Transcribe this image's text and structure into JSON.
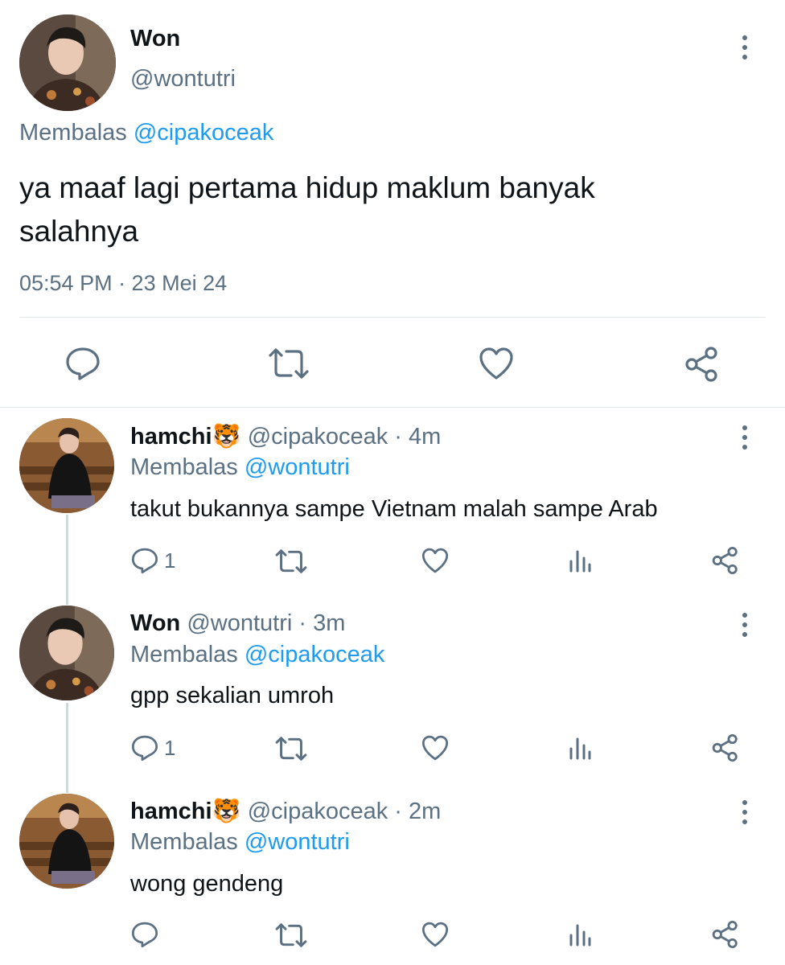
{
  "main_tweet": {
    "display_name": "Won",
    "handle": "@wontutri",
    "reply_prefix": "Membalas",
    "reply_to": "@cipakoceak",
    "text_line1": "ya maaf lagi pertama hidup maklum banyak",
    "text_line2": "salahnya",
    "timestamp": "05:54 PM · 23 Mei 24",
    "actions": [
      "reply-icon",
      "retweet-icon",
      "like-icon",
      "share-icon"
    ]
  },
  "replies": [
    {
      "display_name": "hamchi",
      "emoji": "🐯",
      "handle": "@cipakoceak",
      "time": "· 4m",
      "reply_prefix": "Membalas",
      "reply_to": "@wontutri",
      "text": "takut bukannya sampe Vietnam malah sampe Arab",
      "reply_count": "1",
      "actions": [
        "reply-icon",
        "retweet-icon",
        "like-icon",
        "analytics-icon",
        "share-icon"
      ]
    },
    {
      "display_name": "Won",
      "emoji": "",
      "handle": "@wontutri",
      "time": "· 3m",
      "reply_prefix": "Membalas",
      "reply_to": "@cipakoceak",
      "text": "gpp sekalian umroh",
      "reply_count": "1",
      "actions": [
        "reply-icon",
        "retweet-icon",
        "like-icon",
        "analytics-icon",
        "share-icon"
      ]
    },
    {
      "display_name": "hamchi",
      "emoji": "🐯",
      "handle": "@cipakoceak",
      "time": "· 2m",
      "reply_prefix": "Membalas",
      "reply_to": "@wontutri",
      "text": "wong gendeng",
      "reply_count": "",
      "actions": [
        "reply-icon",
        "retweet-icon",
        "like-icon",
        "analytics-icon",
        "share-icon"
      ]
    }
  ],
  "colors": {
    "link": "#1d9bf0",
    "muted": "#5b7083",
    "text": "#0f1419",
    "divider": "#e1e8ed"
  }
}
